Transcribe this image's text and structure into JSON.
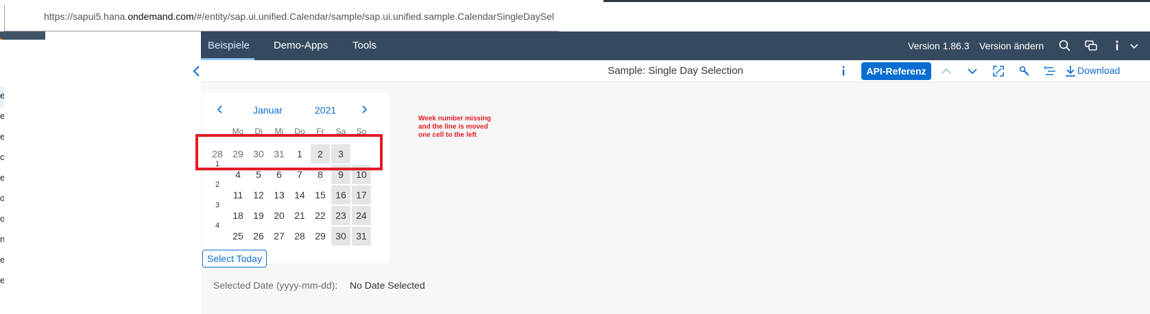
{
  "browser": {
    "url_prefix": "https://sapui5.hana.",
    "url_host": "ondemand.com",
    "url_suffix": "/#/entity/sap.ui.unified.Calendar/sample/sap.ui.unified.sample.CalendarSingleDaySelect"
  },
  "left_list": {
    "items": [
      "e",
      "e",
      "e",
      "c",
      "e",
      "o",
      "o",
      "n",
      "e",
      "e"
    ]
  },
  "shell": {
    "tabs": [
      {
        "label": "Beispiele",
        "active": true
      },
      {
        "label": "Demo-Apps",
        "active": false
      },
      {
        "label": "Tools",
        "active": false
      }
    ],
    "version": "Version 1.86.3",
    "change_version": "Version ändern",
    "icons": [
      "search-icon",
      "feedback-icon",
      "info-icon",
      "chevron-down-icon"
    ]
  },
  "sample_header": {
    "title": "Sample: Single Day Selection",
    "api_button": "API-Referenz",
    "download": "Download",
    "icons": [
      "back-icon",
      "info-icon",
      "chevron-up-icon",
      "chevron-down-icon",
      "fullscreen-icon",
      "settings-wrench-icon",
      "rtl-toggle-icon",
      "download-icon"
    ]
  },
  "calendar": {
    "month": "Januar",
    "year": "2021",
    "weekdays": [
      "Mo",
      "Di",
      "Mi",
      "Do",
      "Fr",
      "Sa",
      "So"
    ],
    "first_row": [
      "28",
      "29",
      "30",
      "31",
      "1",
      "2",
      "3"
    ],
    "weeks": [
      {
        "num": "1",
        "days": [
          "4",
          "5",
          "6",
          "7",
          "8",
          "9",
          "10"
        ]
      },
      {
        "num": "2",
        "days": [
          "11",
          "12",
          "13",
          "14",
          "15",
          "16",
          "17"
        ]
      },
      {
        "num": "3",
        "days": [
          "18",
          "19",
          "20",
          "21",
          "22",
          "23",
          "24"
        ]
      },
      {
        "num": "4",
        "days": [
          "25",
          "26",
          "27",
          "28",
          "29",
          "30",
          "31"
        ]
      }
    ]
  },
  "annotation": {
    "text": "Week number missing and the line is moved one cell to the left",
    "color": "#e31b23"
  },
  "controls": {
    "select_today": "Select Today",
    "selected_label": "Selected Date (yyyy-mm-dd):",
    "selected_value": "No Date Selected"
  },
  "colors": {
    "shell_bg": "#354a5f",
    "accent": "#0a6ed1",
    "weekend_bg": "#e5e5e5",
    "annotation": "#e31b23"
  }
}
